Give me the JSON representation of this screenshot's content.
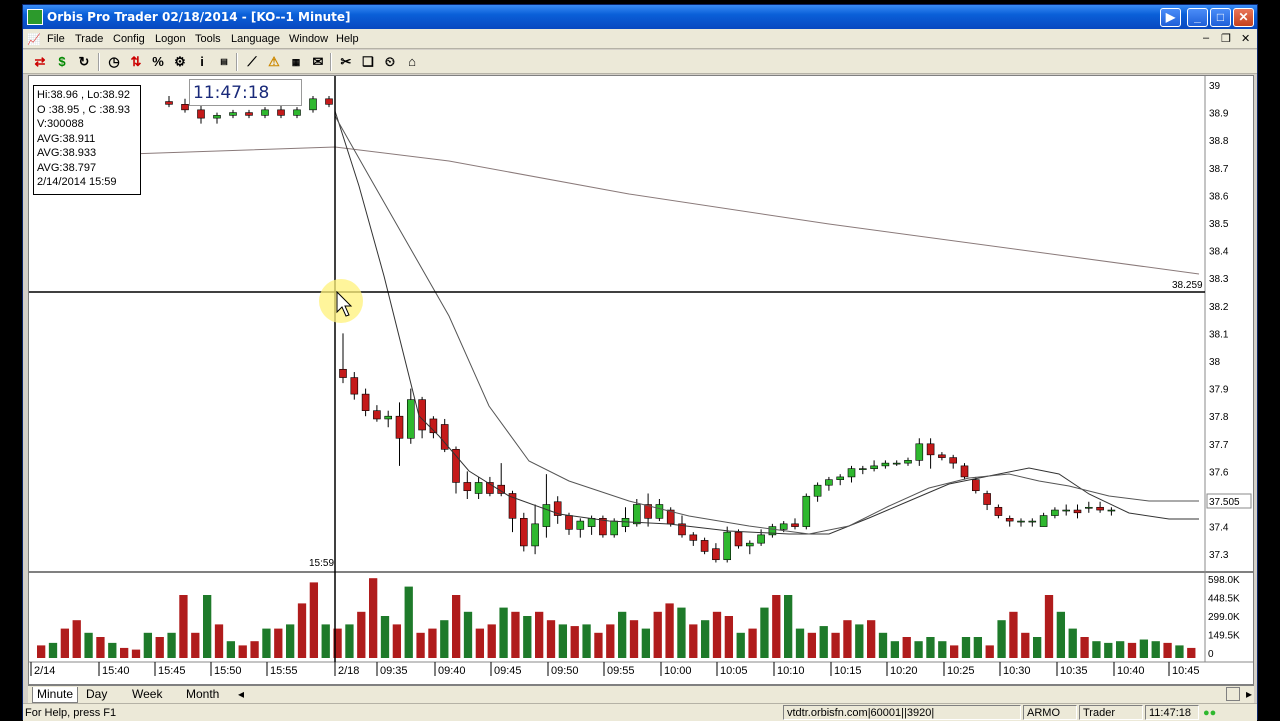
{
  "window": {
    "title": "Orbis Pro Trader  02/18/2014 - [KO--1 Minute]"
  },
  "menu": [
    "File",
    "Trade",
    "Config",
    "Logon",
    "Tools",
    "Language",
    "Window",
    "Help"
  ],
  "toolbar_icons": [
    "swap-icon",
    "dollar-icon",
    "refresh-icon",
    "clock-icon",
    "chart-arrows-icon",
    "percent-icon",
    "gear-arrow-icon",
    "info-icon",
    "ticker-icon",
    "line-chart-icon",
    "alert-icon",
    "news-icon",
    "mail-icon",
    "tools-icon",
    "windows-icon",
    "timer-icon",
    "home-icon"
  ],
  "info_box": {
    "hi_lo": "Hi:38.96 , Lo:38.92",
    "open_close": "O :38.95 , C :38.93",
    "volume": "V:300088",
    "avg1": "AVG:38.911",
    "avg2": "AVG:38.933",
    "avg3": "AVG:38.797",
    "datetime": "2/14/2014 15:59"
  },
  "crosshair_time": "11:47:18",
  "crosshair_x_label": "15:59",
  "crosshair_price_label": "38.259",
  "last_price_label": "37.505",
  "price_axis": [
    "39",
    "38.9",
    "38.8",
    "38.7",
    "38.6",
    "38.5",
    "38.4",
    "38.3",
    "38.2",
    "38.1",
    "38",
    "37.9",
    "37.8",
    "37.7",
    "37.6",
    "37.5",
    "37.4",
    "37.3"
  ],
  "volume_axis": [
    "598.0K",
    "448.5K",
    "299.0K",
    "149.5K",
    "0"
  ],
  "time_axis": [
    "2/14",
    "15:40",
    "15:45",
    "15:50",
    "15:55",
    "2/18",
    "09:35",
    "09:40",
    "09:45",
    "09:50",
    "09:55",
    "10:00",
    "10:05",
    "10:10",
    "10:15",
    "10:20",
    "10:25",
    "10:30",
    "10:35",
    "10:40",
    "10:45"
  ],
  "tabs": [
    "Minute",
    "Day",
    "Week",
    "Month"
  ],
  "status": {
    "help": "For Help, press F1",
    "server": "vtdtr.orbisfn.com|60001||3920|",
    "user": "ARMO",
    "role": "Trader",
    "clock": "11:47:18"
  },
  "colors": {
    "up": "#2fb82f",
    "down": "#c41a1a",
    "vol_up": "#1e7a2a",
    "vol_down": "#b01c1c",
    "title_bar": "#0a5fd8"
  }
}
